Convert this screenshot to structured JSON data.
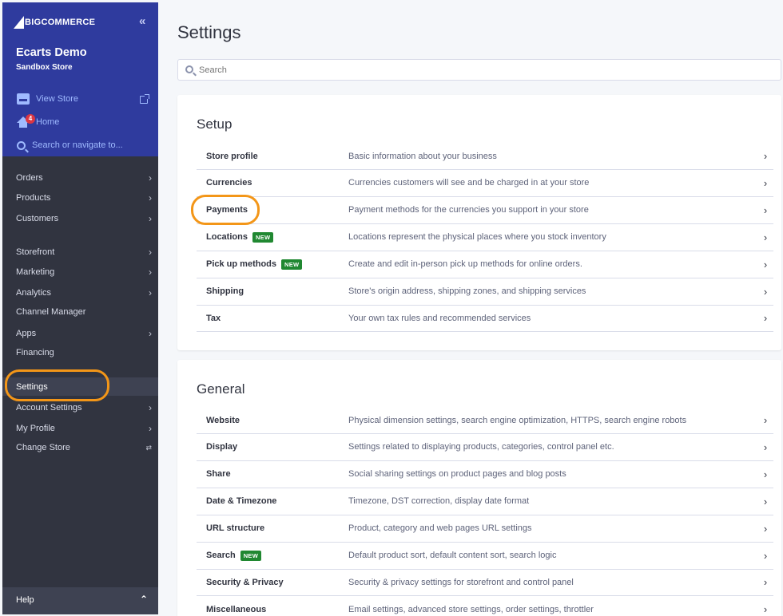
{
  "brand": {
    "logo_text": "BIGCOMMERCE"
  },
  "store": {
    "name": "Ecarts Demo",
    "type": "Sandbox Store"
  },
  "top_links": {
    "view_store": "View Store",
    "home": "Home",
    "home_badge": "4",
    "search": "Search or navigate to..."
  },
  "nav": {
    "orders": "Orders",
    "products": "Products",
    "customers": "Customers",
    "storefront": "Storefront",
    "marketing": "Marketing",
    "analytics": "Analytics",
    "channel_manager": "Channel Manager",
    "apps": "Apps",
    "financing": "Financing",
    "settings": "Settings",
    "account_settings": "Account Settings",
    "my_profile": "My Profile",
    "change_store": "Change Store",
    "help": "Help"
  },
  "main": {
    "title": "Settings",
    "search_placeholder": "Search"
  },
  "setup": {
    "heading": "Setup",
    "rows": [
      {
        "name": "Store profile",
        "desc": "Basic information about your business"
      },
      {
        "name": "Currencies",
        "desc": "Currencies customers will see and be charged in at your store"
      },
      {
        "name": "Payments",
        "desc": "Payment methods for the currencies you support in your store"
      },
      {
        "name": "Locations",
        "badge": "NEW",
        "desc": "Locations represent the physical places where you stock inventory"
      },
      {
        "name": "Pick up methods",
        "badge": "NEW",
        "desc": "Create and edit in-person pick up methods for online orders."
      },
      {
        "name": "Shipping",
        "desc": "Store's origin address, shipping zones, and shipping services"
      },
      {
        "name": "Tax",
        "desc": "Your own tax rules and recommended services"
      }
    ]
  },
  "general": {
    "heading": "General",
    "rows": [
      {
        "name": "Website",
        "desc": "Physical dimension settings, search engine optimization, HTTPS, search engine robots"
      },
      {
        "name": "Display",
        "desc": "Settings related to displaying products, categories, control panel etc."
      },
      {
        "name": "Share",
        "desc": "Social sharing settings on product pages and blog posts"
      },
      {
        "name": "Date & Timezone",
        "desc": "Timezone, DST correction, display date format"
      },
      {
        "name": "URL structure",
        "desc": "Product, category and web pages URL settings"
      },
      {
        "name": "Search",
        "badge": "NEW",
        "desc": "Default product sort, default content sort, search logic"
      },
      {
        "name": "Security & Privacy",
        "desc": "Security & privacy settings for storefront and control panel"
      },
      {
        "name": "Miscellaneous",
        "desc": "Email settings, advanced store settings, order settings, throttler"
      }
    ]
  },
  "colors": {
    "sidebar_top": "#2f3b9e",
    "sidebar": "#313440",
    "highlight": "#f39618",
    "new_badge": "#208831"
  }
}
